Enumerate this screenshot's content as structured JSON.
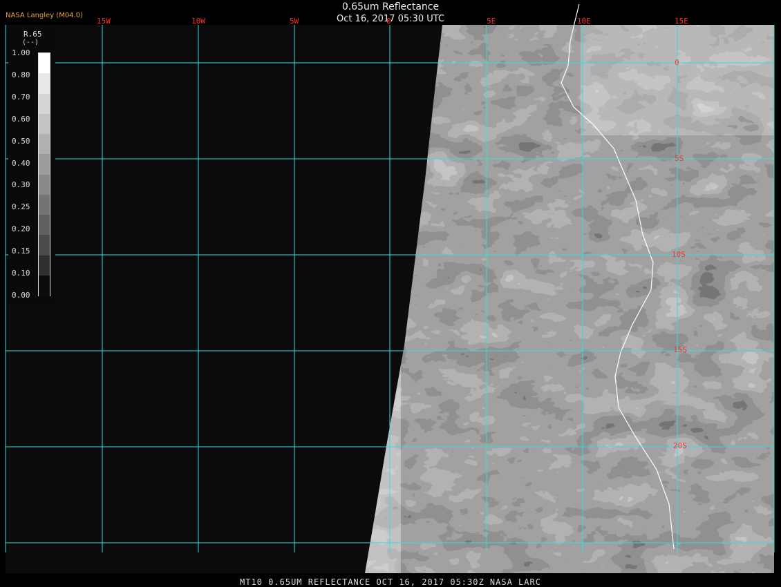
{
  "header": {
    "title": "0.65um Reflectance",
    "subtitle": "Oct 16, 2017 05:30 UTC",
    "credit": "NASA Langley (M04.0)"
  },
  "grid": {
    "lon_labels": [
      "15W",
      "10W",
      "5W",
      "0",
      "5E",
      "10E",
      "15E"
    ],
    "lat_labels": [
      "0",
      "5S",
      "10S",
      "15S",
      "20S"
    ],
    "line_color": "#33dddd",
    "label_color": "#ff3030"
  },
  "legend": {
    "name": "R.65",
    "unit": "(--)",
    "ticks": [
      "1.00",
      "0.80",
      "0.70",
      "0.60",
      "0.50",
      "0.40",
      "0.30",
      "0.25",
      "0.20",
      "0.15",
      "0.10",
      "0.00"
    ],
    "colors": [
      "#ffffff",
      "#e8e8e8",
      "#d6d6d6",
      "#c4c4c4",
      "#b0b0b0",
      "#9c9c9c",
      "#888888",
      "#747474",
      "#606060",
      "#4a4a4a",
      "#303030",
      "#0c0c0c"
    ]
  },
  "footer": "MT10  0.65UM REFLECTANCE   OCT 16, 2017 05:30Z   NASA LARC",
  "colors": {
    "background": "#000000",
    "coastline": "#ffffff"
  }
}
